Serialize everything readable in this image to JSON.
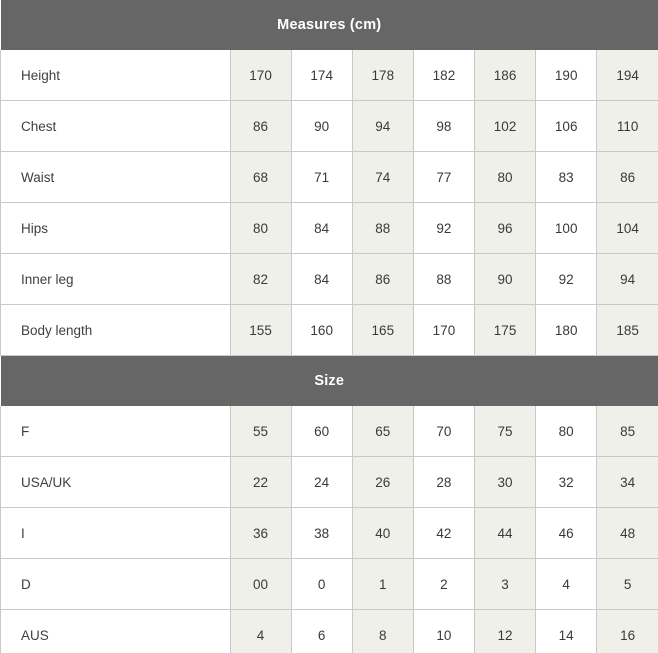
{
  "table": {
    "sections": [
      {
        "header": "Measures (cm)",
        "rows": [
          {
            "label": "Height",
            "values": [
              "170",
              "174",
              "178",
              "182",
              "186",
              "190",
              "194"
            ]
          },
          {
            "label": "Chest",
            "values": [
              "86",
              "90",
              "94",
              "98",
              "102",
              "106",
              "110"
            ]
          },
          {
            "label": "Waist",
            "values": [
              "68",
              "71",
              "74",
              "77",
              "80",
              "83",
              "86"
            ]
          },
          {
            "label": "Hips",
            "values": [
              "80",
              "84",
              "88",
              "92",
              "96",
              "100",
              "104"
            ]
          },
          {
            "label": "Inner leg",
            "values": [
              "82",
              "84",
              "86",
              "88",
              "90",
              "92",
              "94"
            ]
          },
          {
            "label": "Body length",
            "values": [
              "155",
              "160",
              "165",
              "170",
              "175",
              "180",
              "185"
            ]
          }
        ]
      },
      {
        "header": "Size",
        "rows": [
          {
            "label": "F",
            "values": [
              "55",
              "60",
              "65",
              "70",
              "75",
              "80",
              "85"
            ]
          },
          {
            "label": "USA/UK",
            "values": [
              "22",
              "24",
              "26",
              "28",
              "30",
              "32",
              "34"
            ]
          },
          {
            "label": "I",
            "values": [
              "36",
              "38",
              "40",
              "42",
              "44",
              "46",
              "48"
            ]
          },
          {
            "label": "D",
            "values": [
              "00",
              "0",
              "1",
              "2",
              "3",
              "4",
              "5"
            ]
          },
          {
            "label": "AUS",
            "values": [
              "4",
              "6",
              "8",
              "10",
              "12",
              "14",
              "16"
            ]
          }
        ]
      }
    ],
    "column_count": 7,
    "colors": {
      "section_header_background": "#666666",
      "section_header_text": "#ffffff",
      "cell_text": "#3a3a3a",
      "shaded_cell_background": "#eff0ea",
      "plain_cell_background": "#ffffff",
      "border": "#c9c9c9"
    }
  }
}
